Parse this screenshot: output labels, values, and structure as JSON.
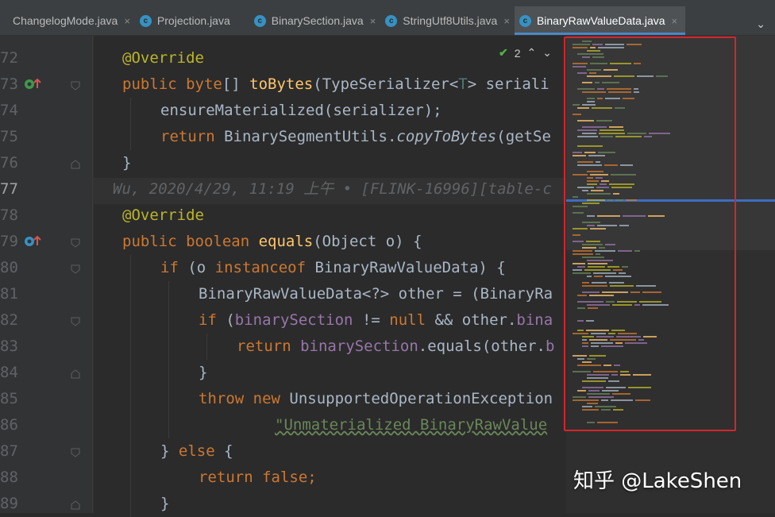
{
  "tabs": [
    {
      "label": "ChangelogMode.java",
      "icon": "class-icon",
      "close": "×"
    },
    {
      "label": "Projection.java",
      "icon": "class-icon",
      "close": "×"
    },
    {
      "label": "BinarySection.java",
      "icon": "class-icon",
      "close": "×"
    },
    {
      "label": "StringUtf8Utils.java",
      "icon": "class-icon",
      "close": "×"
    },
    {
      "label": "BinaryRawValueData.java",
      "icon": "class-icon",
      "close": "×",
      "active": true
    }
  ],
  "tab_overflow": "⌄",
  "inspection": {
    "count": "2",
    "up": "⌃",
    "down": "⌄"
  },
  "line_numbers": [
    "72",
    "73",
    "74",
    "75",
    "76",
    "77",
    "78",
    "79",
    "80",
    "81",
    "82",
    "83",
    "84",
    "85",
    "86",
    "87",
    "88",
    "89"
  ],
  "code": {
    "l72_ann": "@Override",
    "l73_a": "public byte",
    "l73_b": "[] ",
    "l73_fn": "toBytes",
    "l73_c": "(TypeSerializer<",
    "l73_tp": "T",
    "l73_d": "> seriali",
    "l74": "ensureMaterialized(serializer);",
    "l75_kw": "return ",
    "l75_a": "BinarySegmentUtils.",
    "l75_it": "copyToBytes",
    "l75_b": "(getSe",
    "l76": "}",
    "l77_blame": "Wu, 2020/4/29, 11:19 上午 • [FLINK-16996][table-c",
    "l78_ann": "@Override",
    "l79_kw": "public boolean ",
    "l79_fn": "equals",
    "l79_a": "(Object o) {",
    "l80_kw1": "if ",
    "l80_a": "(o ",
    "l80_kw2": "instanceof ",
    "l80_b": "BinaryRawValueData) {",
    "l81_a": "BinaryRawValueData<?> other = (BinaryRa",
    "l82_kw": "if ",
    "l82_a": "(",
    "l82_fld": "binarySection",
    "l82_b": " != ",
    "l82_kw2": "null ",
    "l82_c": "&& other.",
    "l82_fld2": "bina",
    "l83_kw": "return ",
    "l83_fld": "binarySection",
    "l83_a": ".equals(other.",
    "l83_fld2": "b",
    "l84": "}",
    "l85_kw": "throw new ",
    "l85_a": "UnsupportedOperationException",
    "l86_str": "\"Unmaterialized BinaryRawValue",
    "l87_a": "} ",
    "l87_kw": "else ",
    "l87_b": "{",
    "l88_kw": "return false",
    "l88_a": ";",
    "l89": "}"
  },
  "watermark": "知乎 @LakeShen"
}
